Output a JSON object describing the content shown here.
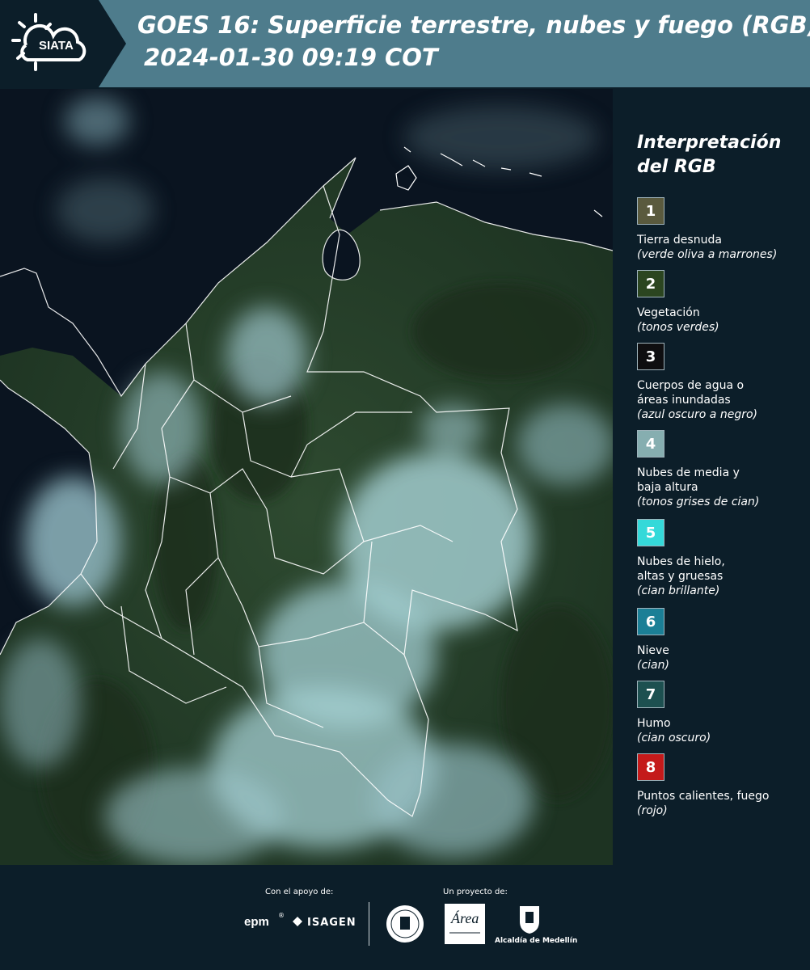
{
  "header": {
    "logo_text": "SIATA",
    "title_line1": "GOES 16: Superficie terrestre, nubes y fuego (RGB)",
    "title_line2": "2024-01-30 09:19 COT"
  },
  "legend": {
    "title": "Interpretación del RGB",
    "items": [
      {
        "num": "1",
        "name": "Tierra desnuda",
        "desc": "(verde oliva a marrones)",
        "color": "#5a5a3e"
      },
      {
        "num": "2",
        "name": "Vegetación",
        "desc": "(tonos verdes)",
        "color": "#2b4520"
      },
      {
        "num": "3",
        "name": "Cuerpos de agua o áreas inundadas",
        "desc": "(azul oscuro a negro)",
        "color": "#0e0e10"
      },
      {
        "num": "4",
        "name": "Nubes de media y baja altura",
        "desc": "(tonos grises de cian)",
        "color": "#86aeb0"
      },
      {
        "num": "5",
        "name": "Nubes de hielo, altas y gruesas",
        "desc": "(cian brillante)",
        "color": "#34d9d9"
      },
      {
        "num": "6",
        "name": "Nieve",
        "desc": "(cian)",
        "color": "#1b7f96"
      },
      {
        "num": "7",
        "name": "Humo",
        "desc": "(cian oscuro)",
        "color": "#1d5050"
      },
      {
        "num": "8",
        "name": "Puntos calientes, fuego",
        "desc": "(rojo)",
        "color": "#c41a1a"
      }
    ]
  },
  "footer": {
    "support_label": "Con el apoyo de:",
    "project_label": "Un proyecto de:",
    "epm": "epm",
    "isagen": "ISAGEN",
    "metro_logo_text": "Área METROPOLITANA Valle de Aburrá",
    "alcaldia": "Alcaldía de Medellín"
  },
  "colors": {
    "header_bg": "#4e7c8c",
    "page_bg": "#0c1e29",
    "border_lines": "#ffffff"
  }
}
